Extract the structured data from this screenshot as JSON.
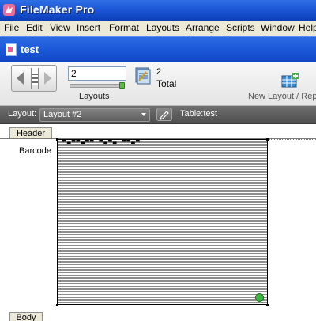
{
  "app": {
    "title": "FileMaker Pro"
  },
  "menu": {
    "items": [
      {
        "label": "File",
        "underline": "F",
        "rest": "ile"
      },
      {
        "label": "Edit",
        "underline": "E",
        "rest": "dit"
      },
      {
        "label": "View",
        "underline": "V",
        "rest": "iew"
      },
      {
        "label": "Insert",
        "underline": "I",
        "rest": "nsert"
      },
      {
        "label": "Format",
        "underline": "",
        "rest": "Format"
      },
      {
        "label": "Layouts",
        "underline": "L",
        "rest": "ayouts"
      },
      {
        "label": "Arrange",
        "underline": "A",
        "rest": "rrange"
      },
      {
        "label": "Scripts",
        "underline": "S",
        "rest": "cripts"
      },
      {
        "label": "Window",
        "underline": "W",
        "rest": "indow"
      },
      {
        "label": "Help",
        "underline": "H",
        "rest": "elp"
      }
    ]
  },
  "document": {
    "title": "test"
  },
  "toolbar": {
    "layout_number": "2",
    "layouts_label": "Layouts",
    "slider_fraction": 1.0,
    "total_count": "2",
    "total_label": "Total",
    "new_layout_label": "New Layout / Rep"
  },
  "layoutbar": {
    "layout_label": "Layout:",
    "layout_value": "Layout #2",
    "table_label": "Table:",
    "table_value": "test"
  },
  "canvas": {
    "header_tab": "Header",
    "body_tab": "Body",
    "field_label": "Barcode",
    "barcode_text": "▀▄▀▀▄▀▀ ▀▄▀▄ ▀▀▄▀"
  },
  "icons": {
    "app": "filemaker-app-icon",
    "document": "document-icon",
    "book": "book-navigation-icon",
    "total": "records-total-icon",
    "new_layout": "new-layout-icon",
    "edit": "pencil-icon"
  },
  "colors": {
    "titlebar": "#1d57d6",
    "menubar": "#ece9d8",
    "layoutbar": "#5e5e5e",
    "slider": "#5dbb44"
  }
}
